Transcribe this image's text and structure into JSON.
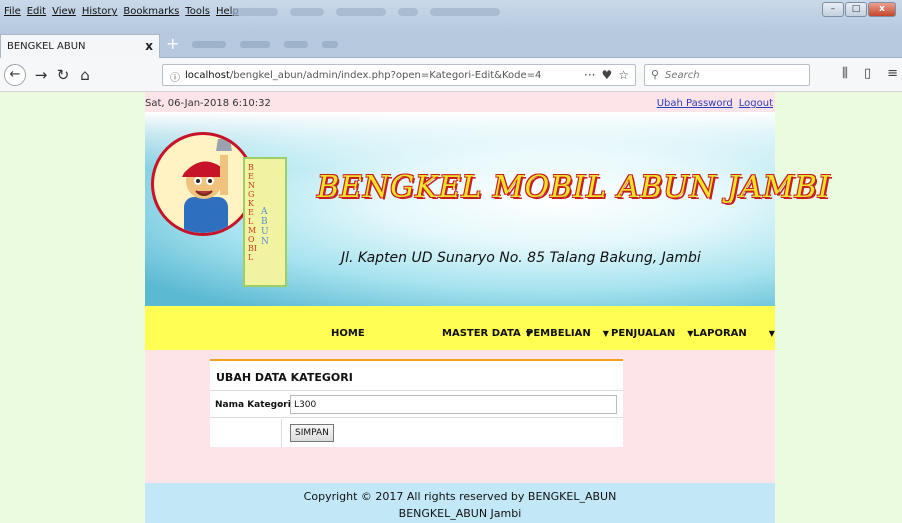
{
  "browser": {
    "menus": [
      "File",
      "Edit",
      "View",
      "History",
      "Bookmarks",
      "Tools",
      "Help"
    ],
    "tab_title": "BENGKEL ABUN",
    "tab_close": "x",
    "new_tab": "+",
    "url_host": "localhost",
    "url_path": "/bengkel_abun/admin/index.php?open=Kategori-Edit&Kode=4",
    "page_actions": "···",
    "search_placeholder": "Search",
    "window_buttons": {
      "minimize": "–",
      "maximize": "□",
      "close": "x"
    }
  },
  "page": {
    "date": "Sat, 06-Jan-2018 6:10:32",
    "links": {
      "change_password": "Ubah Password",
      "logout": "Logout"
    }
  },
  "banner": {
    "title": "BENGKEL MOBIL ABUN JAMBI",
    "subtitle": "Jl. Kapten UD Sunaryo No. 85 Talang Bakung, Jambi",
    "sign_line1": "BENGKEL MOBIL",
    "sign_line2": "ABUN"
  },
  "nav": {
    "home": "HOME",
    "master_data": "MASTER DATA",
    "pembelian": "PEMBELIAN",
    "penjualan": "PENJUALAN",
    "laporan": "LAPORAN",
    "caret": "▼"
  },
  "form": {
    "heading": "UBAH DATA KATEGORI",
    "field_label": "Nama Kategori",
    "colon": ":",
    "field_value": "L300",
    "submit_label": "SIMPAN"
  },
  "footer": {
    "line1": "Copyright © 2017 All rights reserved by BENGKEL_ABUN",
    "line2": "BENGKEL_ABUN Jambi"
  },
  "colors": {
    "page_bg": "#eafbe0",
    "content_bg": "#fde4e9",
    "menu_bg": "#fffe52",
    "footer_bg": "#c2e8f7",
    "form_accent": "#f2a21f",
    "title_yellow": "#f2e22a",
    "title_red": "#c61f1f",
    "link_blue": "#2a3fb8"
  }
}
